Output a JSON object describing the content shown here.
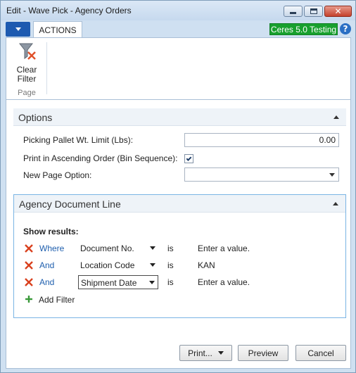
{
  "window": {
    "title": "Edit - Wave Pick - Agency Orders"
  },
  "ribbon": {
    "tab_label": "ACTIONS",
    "environment_badge": "Ceres 5.0 Testing",
    "help_glyph": "?",
    "clear_filter_label": "Clear Filter",
    "group_label": "Page"
  },
  "options": {
    "title": "Options",
    "pallet_label": "Picking Pallet Wt. Limit (Lbs):",
    "pallet_value": "0.00",
    "ascending_label": "Print in Ascending Order (Bin Sequence):",
    "ascending_checked": true,
    "new_page_label": "New Page Option:",
    "new_page_value": ""
  },
  "agency": {
    "title": "Agency Document Line",
    "show_results": "Show results:",
    "filters": [
      {
        "conj": "Where",
        "field": "Document No.",
        "op": "is",
        "value": "Enter a value."
      },
      {
        "conj": "And",
        "field": "Location Code",
        "op": "is",
        "value": "KAN"
      },
      {
        "conj": "And",
        "field": "Shipment Date",
        "op": "is",
        "value": "Enter a value."
      }
    ],
    "add_filter": "Add Filter"
  },
  "buttons": {
    "print": "Print...",
    "preview": "Preview",
    "cancel": "Cancel"
  },
  "colors": {
    "accent": "#1d5ab0",
    "badge": "#18a02e",
    "link": "#1f5fae",
    "remove": "#d9401e",
    "add": "#3a9a3a"
  },
  "icons": [
    "minimize-icon",
    "maximize-icon",
    "close-icon",
    "app-menu-caret-icon",
    "help-icon",
    "clear-filter-icon",
    "collapse-icon",
    "remove-filter-icon",
    "dropdown-icon",
    "add-filter-icon"
  ]
}
